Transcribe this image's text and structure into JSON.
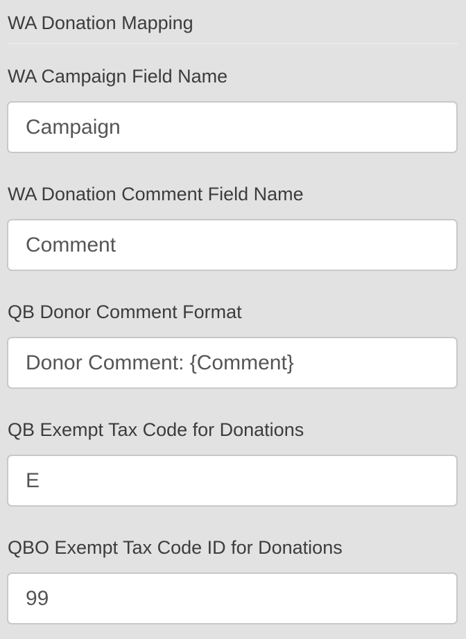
{
  "section": {
    "title": "WA Donation Mapping"
  },
  "fields": [
    {
      "label": "WA Campaign Field Name",
      "value": "Campaign"
    },
    {
      "label": "WA Donation Comment Field Name",
      "value": "Comment"
    },
    {
      "label": "QB Donor Comment Format",
      "value": "Donor Comment: {Comment}"
    },
    {
      "label": "QB Exempt Tax Code for Donations",
      "value": "E"
    },
    {
      "label": "QBO Exempt Tax Code ID for Donations",
      "value": "99"
    }
  ]
}
